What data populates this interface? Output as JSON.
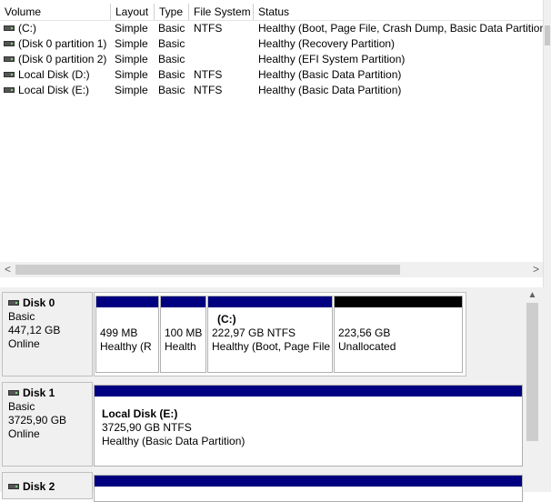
{
  "volume_list": {
    "columns": [
      "Volume",
      "Layout",
      "Type",
      "File System",
      "Status"
    ],
    "rows": [
      {
        "volume": "(C:)",
        "layout": "Simple",
        "type": "Basic",
        "fs": "NTFS",
        "status": "Healthy (Boot, Page File, Crash Dump, Basic Data Partition)"
      },
      {
        "volume": "(Disk 0 partition 1)",
        "layout": "Simple",
        "type": "Basic",
        "fs": "",
        "status": "Healthy (Recovery Partition)"
      },
      {
        "volume": "(Disk 0 partition 2)",
        "layout": "Simple",
        "type": "Basic",
        "fs": "",
        "status": "Healthy (EFI System Partition)"
      },
      {
        "volume": "Local Disk (D:)",
        "layout": "Simple",
        "type": "Basic",
        "fs": "NTFS",
        "status": "Healthy (Basic Data Partition)"
      },
      {
        "volume": "Local Disk (E:)",
        "layout": "Simple",
        "type": "Basic",
        "fs": "NTFS",
        "status": "Healthy (Basic Data Partition)"
      }
    ],
    "hscroll": {
      "left_arrow": "<",
      "right_arrow": ">"
    }
  },
  "disks": [
    {
      "name": "Disk 0",
      "type": "Basic",
      "size": "447,12 GB",
      "state": "Online",
      "partitions": [
        {
          "name": "",
          "size": "499 MB",
          "status": "Healthy (R",
          "allocated": true
        },
        {
          "name": "",
          "size": "100 MB",
          "status": "Health",
          "allocated": true
        },
        {
          "name": "(C:)",
          "size": "222,97 GB NTFS",
          "status": "Healthy (Boot, Page File",
          "allocated": true
        },
        {
          "name": "",
          "size": "223,56 GB",
          "status": "Unallocated",
          "allocated": false
        }
      ]
    },
    {
      "name": "Disk 1",
      "type": "Basic",
      "size": "3725,90 GB",
      "state": "Online",
      "partitions": [
        {
          "name": "Local Disk  (E:)",
          "size": "3725,90 GB NTFS",
          "status": "Healthy (Basic Data Partition)",
          "allocated": true
        }
      ]
    },
    {
      "name": "Disk 2"
    }
  ],
  "colors": {
    "partition_bar": "#000080",
    "unallocated_bar": "#000000"
  }
}
